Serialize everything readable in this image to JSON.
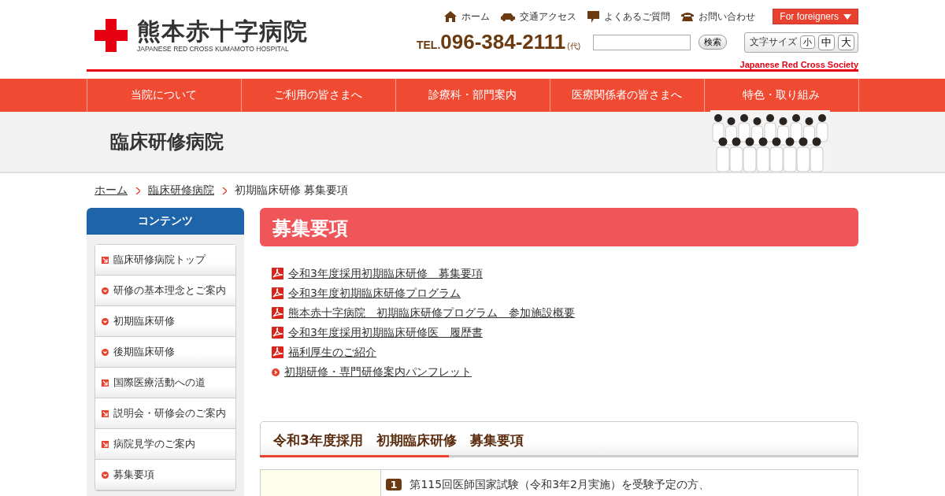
{
  "header": {
    "logo_title": "熊本赤十字病院",
    "logo_subtitle": "JAPANESE RED CROSS KUMAMOTO HOSPITAL",
    "utility_links": [
      {
        "kind": "home",
        "label": "ホーム"
      },
      {
        "kind": "car",
        "label": "交通アクセス"
      },
      {
        "kind": "chat",
        "label": "よくあるご質問"
      },
      {
        "kind": "phone",
        "label": "お問い合わせ"
      }
    ],
    "foreign_button": "For foreigners",
    "tel_prefix": "TEL.",
    "tel_number": "096-384-2111",
    "tel_suffix": "(代)",
    "search_button": "検索",
    "font_size_label": "文字サイズ",
    "font_sizes": [
      "小",
      "中",
      "大"
    ],
    "society": "Japanese Red Cross Society"
  },
  "nav": [
    "当院について",
    "ご利用の皆さまへ",
    "診療科・部門案内",
    "医療関係者の皆さまへ",
    "特色・取り組み"
  ],
  "banner": {
    "title": "臨床研修病院"
  },
  "breadcrumb": [
    {
      "label": "ホーム",
      "link": true
    },
    {
      "label": "臨床研修病院",
      "link": true
    },
    {
      "label": "初期臨床研修 募集要項",
      "link": false
    }
  ],
  "sidebar": {
    "title": "コンテンツ",
    "items": [
      {
        "kind": "square",
        "label": "臨床研修病院トップ"
      },
      {
        "kind": "circle",
        "label": "研修の基本理念とご案内"
      },
      {
        "kind": "circle",
        "label": "初期臨床研修"
      },
      {
        "kind": "circle",
        "label": "後期臨床研修"
      },
      {
        "kind": "square",
        "label": "国際医療活動への道"
      },
      {
        "kind": "square",
        "label": "説明会・研修会のご案内"
      },
      {
        "kind": "square",
        "label": "病院見学のご案内"
      },
      {
        "kind": "circle",
        "label": "募集要項"
      }
    ]
  },
  "main": {
    "title": "募集要項",
    "links": [
      {
        "kind": "pdf",
        "label": "令和3年度採用初期臨床研修　募集要項"
      },
      {
        "kind": "pdf",
        "label": "令和3年度初期臨床研修プログラム"
      },
      {
        "kind": "pdf",
        "label": "熊本赤十字病院　初期臨床研修プログラム　参加施設概要"
      },
      {
        "kind": "pdf",
        "label": "令和3年度採用初期臨床研修医　履歴書"
      },
      {
        "kind": "pdf",
        "label": "福利厚生のご紹介"
      },
      {
        "kind": "link",
        "label": "初期研修・専門研修案内パンフレット"
      }
    ],
    "section_title": "令和3年度採用　初期臨床研修　募集要項",
    "table_rows": [
      {
        "number": "1",
        "text": "第115回医師国家試験（令和3年2月実施）を受験予定の方、"
      }
    ]
  }
}
